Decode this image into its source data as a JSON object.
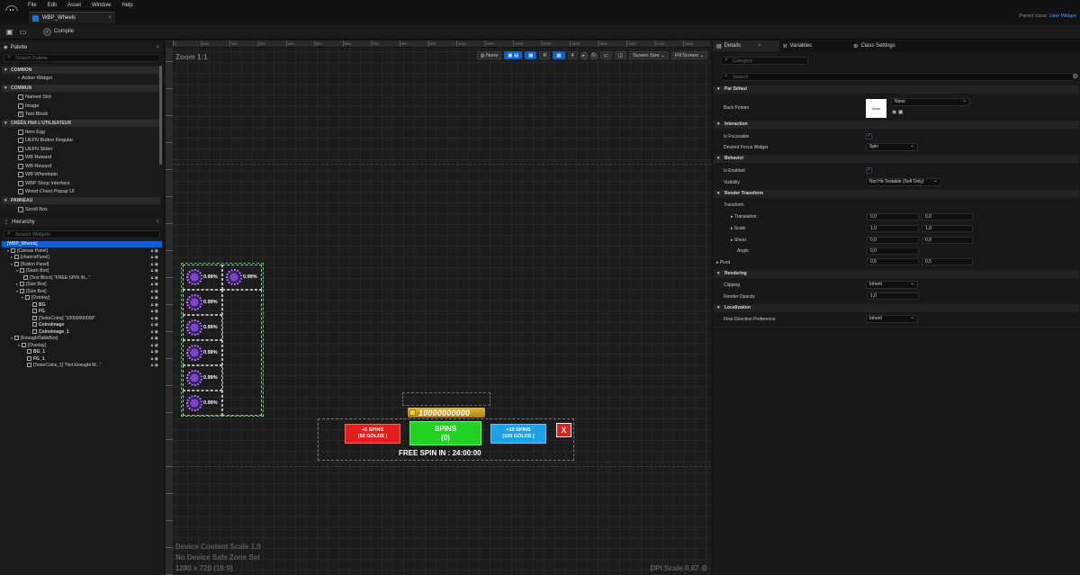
{
  "app": {
    "logo": "U",
    "menu": [
      "File",
      "Edit",
      "Asset",
      "Window",
      "Help"
    ],
    "doc_tab": "WBP_Wheels",
    "doc_tab_close": "×",
    "parent_class_label": "Parent class:",
    "parent_class_value": "User Widget",
    "toolbar": {
      "compile_label": "Compile",
      "compile_status": "✓"
    }
  },
  "palette": {
    "title": "Palette",
    "search_placeholder": "Search Palette",
    "categories": [
      "COMMON",
      "COMMUN",
      "CRÉÉS PAR L'UTILISATEUR",
      "PANNEAU"
    ],
    "common_items": [
      "Action Widget"
    ],
    "commun_items": [
      "Named Slot",
      "Image",
      "Text Block"
    ],
    "user_items": [
      "Item Egg",
      "UEFN Button Regular",
      "UEFN Slider",
      "WB Reward",
      "WB Reward",
      "WB Wheelspin",
      "WBP Shop Interface",
      "Wood Chest Popup UI"
    ],
    "panneau_items": [
      "Scroll Box"
    ]
  },
  "hierarchy": {
    "title": "Hierarchy",
    "search_placeholder": "Search Widgets",
    "rows": [
      "[WBP_Wheels]",
      "[Canvas Panel]",
      "[chancePanel]",
      "[Button Panel]",
      "[Stack Box]",
      "[Text Block] \"FREE SPIN  IN...\"",
      "[Size Box]",
      "[Size Box]",
      "[Overlay]",
      "BG",
      "FG",
      "[TexteCoins] \"10000000000\"",
      "CoinsImage",
      "CoinsImage_1",
      "[EnoughtTailleBox]",
      "[Overlay]",
      "BG_1",
      "FG_1",
      "[TexteCoins_1] \"Not Enought M...\""
    ]
  },
  "canvas": {
    "zoom": "Zoom 1:1",
    "ruler_ticks": [
      "0",
      "100",
      "200",
      "300",
      "400",
      "500",
      "600",
      "700",
      "800",
      "900",
      "1000",
      "1100",
      "1200",
      "1300",
      "1400",
      "1500",
      "1600",
      "1700",
      "1800"
    ],
    "tools": {
      "none": "None",
      "r": "R",
      "four": "4",
      "screen_size": "Screen Size",
      "fill_screen": "Fill Screen"
    },
    "chance_values": [
      "0.99%",
      "0.99%",
      "0.99%",
      "0.99%",
      "0.99%",
      "0.99%",
      "0.99%",
      "0.99%"
    ],
    "coins_value": "10000000000",
    "btn_red": {
      "line1": "+5 SPINS",
      "line2": "(50 GOLDS )"
    },
    "btn_green": {
      "line1": "SPINS",
      "line2": "(0)"
    },
    "btn_blue": {
      "line1": "+10 SPINS",
      "line2": "(100 GOLDS )"
    },
    "close": "X",
    "free_spin": "FREE SPIN  IN : 24:00:00",
    "footer": [
      "Device Content Scale 1,0",
      "No Device Safe Zone Set",
      "1280 x 720 (16:9)"
    ],
    "dpi": "DPI Scale 0,67"
  },
  "details": {
    "tabs": [
      "Details",
      "Variables",
      "Class Settings"
    ],
    "category_placeholder": "Category",
    "search_placeholder": "Search",
    "sections": {
      "par_defaut": "Par Défaut",
      "interaction": "Interaction",
      "behavior": "Behavior",
      "render_transform": "Render Transform",
      "rendering": "Rendering",
      "localization": "Localization"
    },
    "back_pointer_label": "Back Pointer",
    "back_pointer_thumb": "None",
    "back_pointer_value": "None",
    "is_focusable": "Is Focusable",
    "desired_focus": "Desired Focus Widget",
    "desired_focus_value": "Spin",
    "is_enabled": "Is Enabled",
    "visibility": "Visibility",
    "visibility_value": "Not Hit-Testable (Self Only)",
    "transform": "Transform",
    "translation": "Translation",
    "translation_x": "0,0",
    "translation_y": "0,0",
    "scale": "Scale",
    "scale_x": "1,0",
    "scale_y": "1,0",
    "shear": "Shear",
    "shear_x": "0,0",
    "shear_y": "0,0",
    "angle": "Angle",
    "angle_value": "0,0",
    "pivot": "Pivot",
    "pivot_x": "0,5",
    "pivot_y": "0,5",
    "clipping": "Clipping",
    "clipping_value": "Inherit",
    "render_opacity": "Render Opacity",
    "render_opacity_value": "1,0",
    "flow_direction": "Flow Direction Preference",
    "flow_direction_value": "Inherit"
  },
  "colors": {
    "accent": "#0b5fd6",
    "spin_red": "#e41d1d",
    "spin_green": "#22d326",
    "spin_blue": "#1da0e6",
    "coins_gold": "#e7b830",
    "chance_outline": "#4cd05a"
  }
}
